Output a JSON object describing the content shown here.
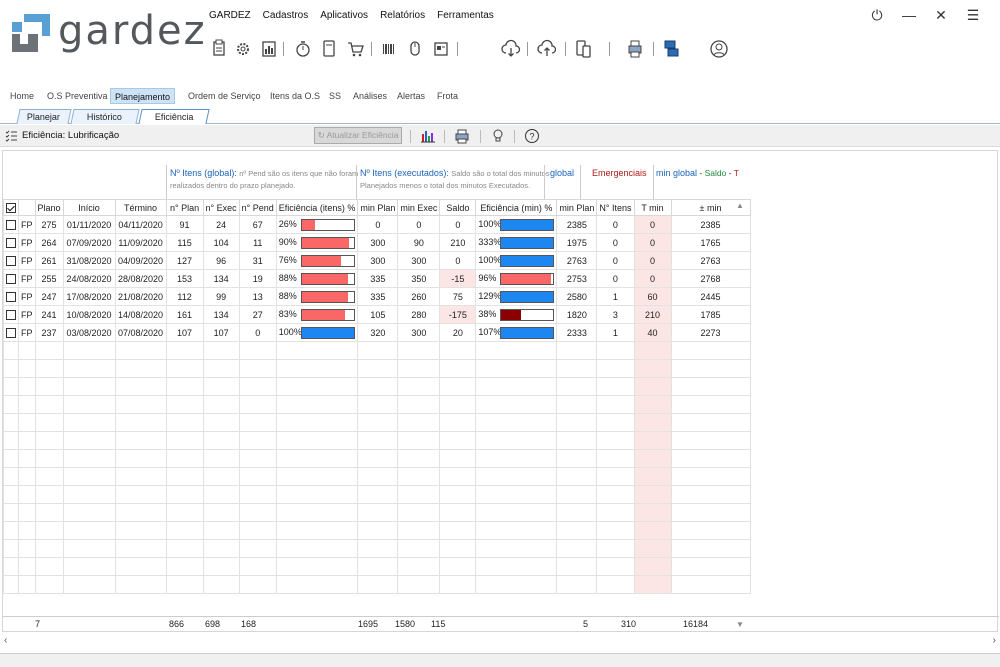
{
  "app": {
    "name": "gardez"
  },
  "menu": [
    "GARDEZ",
    "Cadastros",
    "Aplicativos",
    "Relatórios",
    "Ferramentas"
  ],
  "window_controls": [
    "power-icon",
    "minimize-icon",
    "close-icon",
    "hamburger-menu-icon"
  ],
  "toolbar_icons": [
    "clipboard-icon",
    "gear-icon",
    "report-icon",
    "stopwatch-icon",
    "document-icon",
    "cart-icon",
    "barcode-icon",
    "mouse-icon",
    "card-icon",
    "cloud-download-icon",
    "cloud-upload-icon",
    "mobile-sync-icon",
    "printer-settings-icon",
    "computer-group-icon",
    "user-icon"
  ],
  "nav_tabs": [
    "Home",
    "O.S Preventiva",
    "Planejamento",
    "Ordem de Serviço",
    "Itens da O.S",
    "SS",
    "Análises",
    "Alertas",
    "Frota"
  ],
  "active_nav_tab": "Planejamento",
  "sub_tabs": [
    "Planejar",
    "Histórico",
    "Eficiência"
  ],
  "active_sub_tab": "Eficiência",
  "action_bar": {
    "title": "Eficiência: Lubrificação",
    "refresh_label": "Atualizar Eficiência"
  },
  "groups": {
    "itens_global_title": "Nº Itens (global):",
    "itens_global_note_1": "nº Pend são os itens que não foram",
    "itens_global_note_2": "realizados dentro do prazo planejado.",
    "itens_exec_title": "Nº Itens (executados):",
    "itens_exec_note_1": "Saldo são o total dos minutos",
    "itens_exec_note_2": "Planejados menos o total dos minutos Executados.",
    "global": "global",
    "emergenciais": "Emergenciais",
    "min_global": "min global",
    "saldo": "Saldo",
    "t": "T"
  },
  "columns": [
    "",
    "",
    "Plano",
    "Início",
    "Término",
    "n° Plan",
    "n° Exec",
    "n° Pend",
    "Eficiência (itens) %",
    "min Plan",
    "min Exec",
    "Saldo",
    "Eficiência (min) %",
    "min Plan",
    "N° Itens",
    "T min",
    "± min"
  ],
  "colors": {
    "red_bar": "#f96767",
    "blue_bar": "#1e86f0",
    "dark_red_bar": "#8b0000",
    "accent": "#1a63b8"
  },
  "rows": [
    {
      "type": "FP",
      "plano": "275",
      "inicio": "01/11/2020",
      "termino": "04/11/2020",
      "n_plan": "91",
      "n_exec": "24",
      "n_pend": "67",
      "ef_itens": "26%",
      "ef_itens_val": 0.26,
      "ef_itens_color": "red",
      "min_plan": "0",
      "min_exec": "0",
      "saldo": "0",
      "saldo_neg": false,
      "ef_min": "100%",
      "ef_min_val": 1.0,
      "ef_min_color": "blue",
      "g_min_plan": "2385",
      "n_itens": "0",
      "t_min": "0",
      "pm_min": "2385"
    },
    {
      "type": "FP",
      "plano": "264",
      "inicio": "07/09/2020",
      "termino": "11/09/2020",
      "n_plan": "115",
      "n_exec": "104",
      "n_pend": "11",
      "ef_itens": "90%",
      "ef_itens_val": 0.9,
      "ef_itens_color": "red",
      "min_plan": "300",
      "min_exec": "90",
      "saldo": "210",
      "saldo_neg": false,
      "ef_min": "333%",
      "ef_min_val": 1.0,
      "ef_min_color": "blue",
      "g_min_plan": "1975",
      "n_itens": "0",
      "t_min": "0",
      "pm_min": "1765"
    },
    {
      "type": "FP",
      "plano": "261",
      "inicio": "31/08/2020",
      "termino": "04/09/2020",
      "n_plan": "127",
      "n_exec": "96",
      "n_pend": "31",
      "ef_itens": "76%",
      "ef_itens_val": 0.76,
      "ef_itens_color": "red",
      "min_plan": "300",
      "min_exec": "300",
      "saldo": "0",
      "saldo_neg": false,
      "ef_min": "100%",
      "ef_min_val": 1.0,
      "ef_min_color": "blue",
      "g_min_plan": "2763",
      "n_itens": "0",
      "t_min": "0",
      "pm_min": "2763"
    },
    {
      "type": "FP",
      "plano": "255",
      "inicio": "24/08/2020",
      "termino": "28/08/2020",
      "n_plan": "153",
      "n_exec": "134",
      "n_pend": "19",
      "ef_itens": "88%",
      "ef_itens_val": 0.88,
      "ef_itens_color": "red",
      "min_plan": "335",
      "min_exec": "350",
      "saldo": "-15",
      "saldo_neg": true,
      "ef_min": "96%",
      "ef_min_val": 0.96,
      "ef_min_color": "red",
      "g_min_plan": "2753",
      "n_itens": "0",
      "t_min": "0",
      "pm_min": "2768"
    },
    {
      "type": "FP",
      "plano": "247",
      "inicio": "17/08/2020",
      "termino": "21/08/2020",
      "n_plan": "112",
      "n_exec": "99",
      "n_pend": "13",
      "ef_itens": "88%",
      "ef_itens_val": 0.88,
      "ef_itens_color": "red",
      "min_plan": "335",
      "min_exec": "260",
      "saldo": "75",
      "saldo_neg": false,
      "ef_min": "129%",
      "ef_min_val": 1.0,
      "ef_min_color": "blue",
      "g_min_plan": "2580",
      "n_itens": "1",
      "t_min": "60",
      "pm_min": "2445"
    },
    {
      "type": "FP",
      "plano": "241",
      "inicio": "10/08/2020",
      "termino": "14/08/2020",
      "n_plan": "161",
      "n_exec": "134",
      "n_pend": "27",
      "ef_itens": "83%",
      "ef_itens_val": 0.83,
      "ef_itens_color": "red",
      "min_plan": "105",
      "min_exec": "280",
      "saldo": "-175",
      "saldo_neg": true,
      "ef_min": "38%",
      "ef_min_val": 0.38,
      "ef_min_color": "darkred",
      "g_min_plan": "1820",
      "n_itens": "3",
      "t_min": "210",
      "pm_min": "1785"
    },
    {
      "type": "FP",
      "plano": "237",
      "inicio": "03/08/2020",
      "termino": "07/08/2020",
      "n_plan": "107",
      "n_exec": "107",
      "n_pend": "0",
      "ef_itens": "100%",
      "ef_itens_val": 1.0,
      "ef_itens_color": "blue",
      "min_plan": "320",
      "min_exec": "300",
      "saldo": "20",
      "saldo_neg": false,
      "ef_min": "107%",
      "ef_min_val": 1.0,
      "ef_min_color": "blue",
      "g_min_plan": "2333",
      "n_itens": "1",
      "t_min": "40",
      "pm_min": "2273"
    }
  ],
  "totals": {
    "count": "7",
    "n_plan": "866",
    "n_exec": "698",
    "n_pend": "168",
    "min_plan": "1695",
    "min_exec": "1580",
    "saldo": "115",
    "n_itens": "5",
    "t_min": "310",
    "pm_min": "16184"
  }
}
